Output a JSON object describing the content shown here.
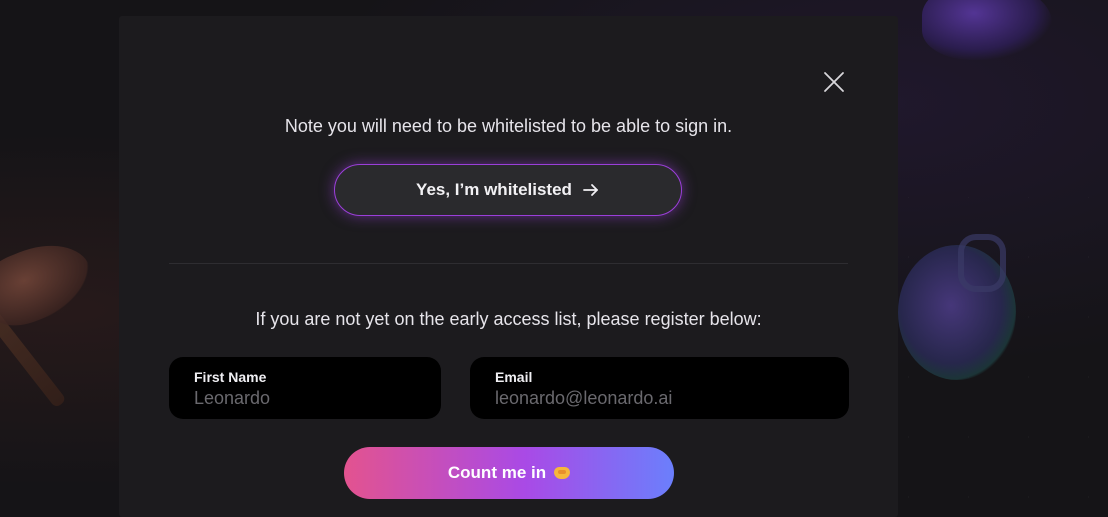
{
  "modal": {
    "note": "Note you will need to be whitelisted to be able to sign in.",
    "whitelist_button": "Yes, I’m whitelisted",
    "register_prompt": "If you are not yet on the early access list, please register below:",
    "fields": {
      "first_name": {
        "label": "First Name",
        "value": "",
        "placeholder": "Leonardo"
      },
      "email": {
        "label": "Email",
        "value": "",
        "placeholder": "leonardo@leonardo.ai"
      }
    },
    "submit_button": "Count me in",
    "icons": {
      "close": "close-icon",
      "arrow": "arrow-right-icon",
      "emoji": "handshake-icon"
    }
  },
  "colors": {
    "background": "#151417",
    "modal_bg": "#1c1b1e",
    "accent_purple": "#9b3fd9",
    "gradient_start": "#e3538f",
    "gradient_end": "#6b7ffc"
  }
}
